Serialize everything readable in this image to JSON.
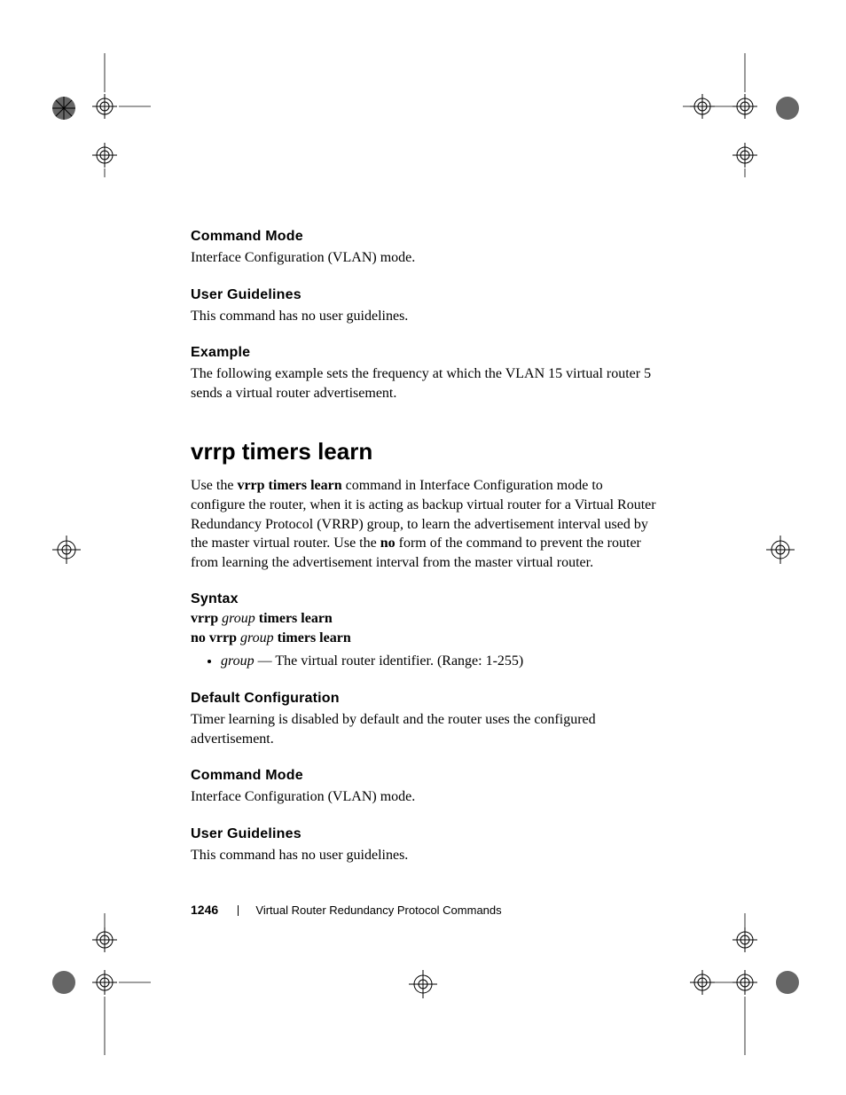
{
  "footer": {
    "page_number": "1246",
    "section_title": "Virtual Router Redundancy Protocol Commands"
  },
  "sections": {
    "cmd_mode1": {
      "head": "Command Mode",
      "body": "Interface Configuration (VLAN) mode."
    },
    "user_guide1": {
      "head": "User Guidelines",
      "body": "This command has no user guidelines."
    },
    "example": {
      "head": "Example",
      "body": "The following example sets the frequency at which the VLAN 15 virtual router 5 sends a virtual router advertisement."
    },
    "cmd_title": "vrrp timers learn",
    "cmd_intro": {
      "pre": "Use the ",
      "bold1": "vrrp timers learn",
      "mid": " command in Interface Configuration mode to configure the router, when it is acting as backup virtual router for a Virtual Router Redundancy Protocol (VRRP) group, to learn the advertisement interval used by the master virtual router. Use the ",
      "bold2": "no",
      "post": " form of the command to prevent the router from learning the advertisement interval from the master virtual router."
    },
    "syntax": {
      "head": "Syntax",
      "line1": {
        "b1": "vrrp ",
        "i": "group",
        "b2": " timers learn"
      },
      "line2": {
        "b1": "no vrrp ",
        "i": "group",
        "b2": " timers learn"
      },
      "bullet": {
        "i": "group",
        "rest": " — The virtual router identifier. (Range: 1-255)"
      }
    },
    "default_cfg": {
      "head": "Default Configuration",
      "body": "Timer learning is disabled by default and the router uses the configured advertisement."
    },
    "cmd_mode2": {
      "head": "Command Mode",
      "body": "Interface Configuration (VLAN) mode."
    },
    "user_guide2": {
      "head": "User Guidelines",
      "body": "This command has no user guidelines."
    }
  }
}
